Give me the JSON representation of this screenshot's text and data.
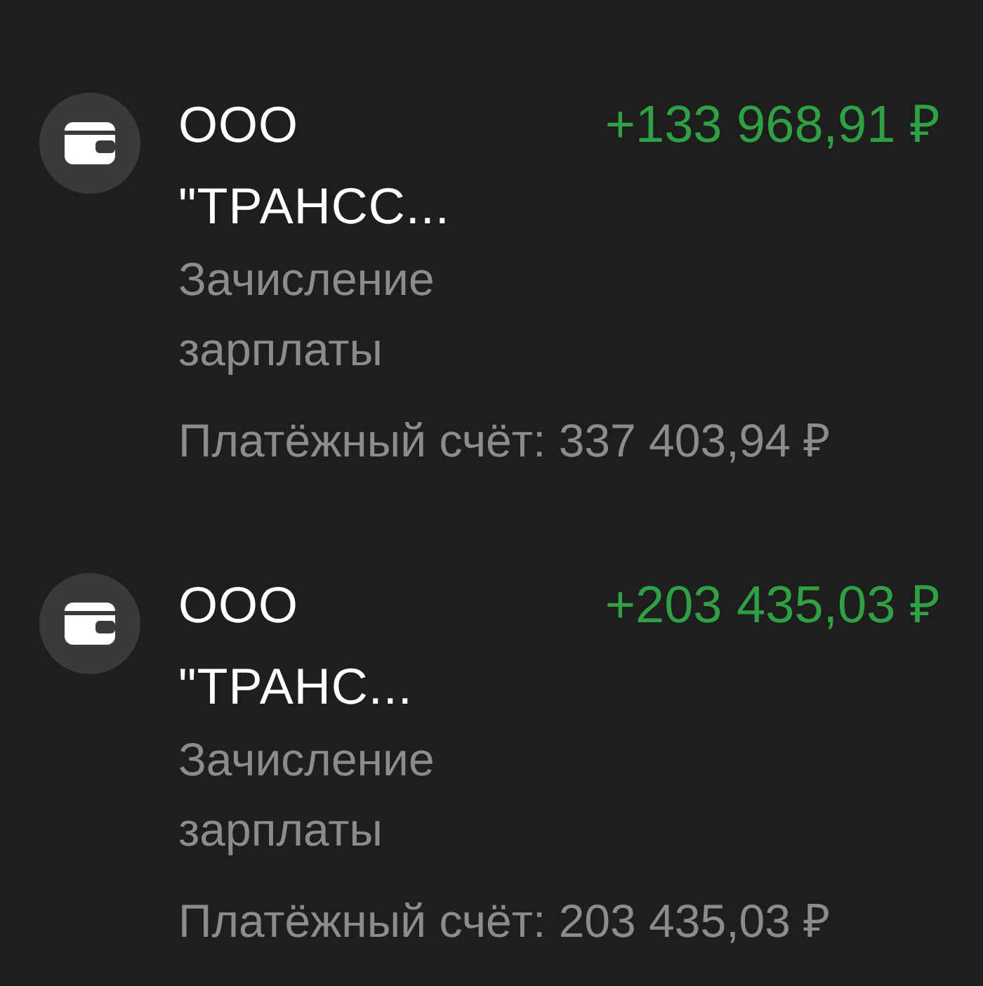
{
  "transactions": [
    {
      "title": "ООО \"ТРАНСС...",
      "amount": "+133 968,91 ₽",
      "description": "Зачисление зарплаты",
      "balance": "Платёжный счёт: 337 403,94 ₽"
    },
    {
      "title": "ООО \"ТРАНС...",
      "amount": "+203 435,03 ₽",
      "description": "Зачисление зарплаты",
      "balance": "Платёжный счёт: 203 435,03 ₽"
    }
  ]
}
